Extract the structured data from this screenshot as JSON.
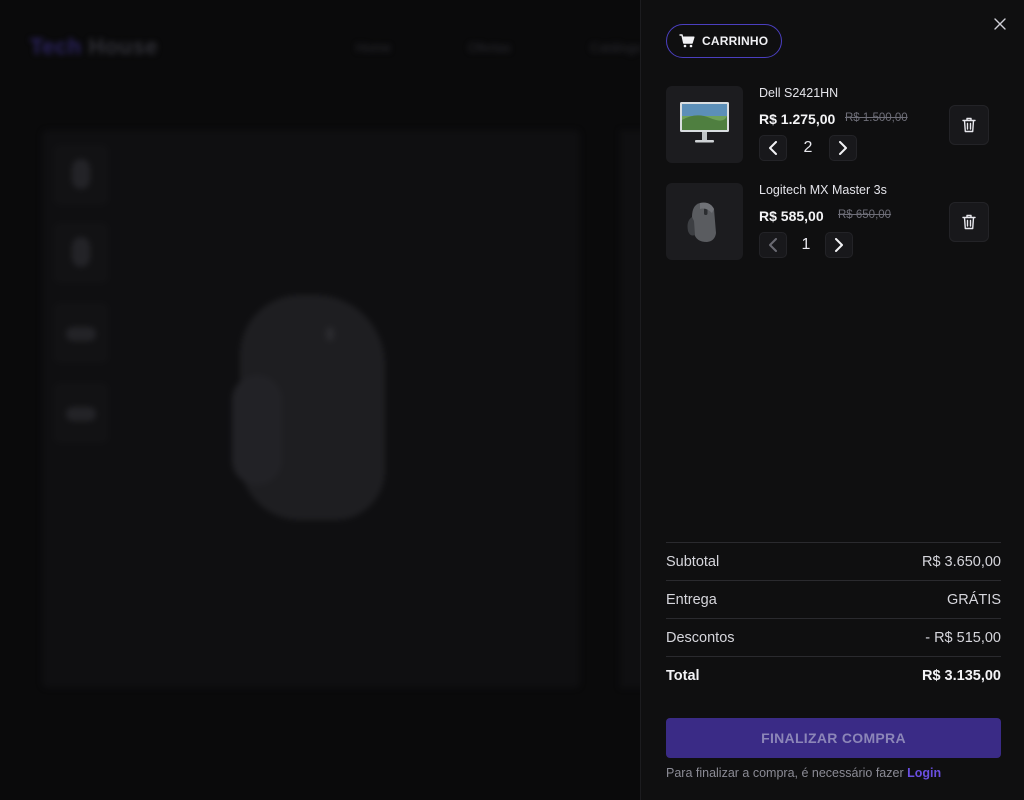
{
  "background": {
    "logo_part1": "Tech",
    "logo_part2": "House",
    "nav": [
      "Home",
      "Ofertas",
      "Catálogo"
    ]
  },
  "cart": {
    "title": "CARRINHO",
    "items": [
      {
        "name": "Dell S2421HN",
        "price": "R$ 1.275,00",
        "old_price": "R$ 1.500,00",
        "quantity": "2",
        "image_icon": "monitor-icon"
      },
      {
        "name": "Logitech MX Master 3s",
        "price": "R$ 585,00",
        "old_price": "R$ 650,00",
        "quantity": "1",
        "image_icon": "mouse-icon"
      }
    ],
    "summary": {
      "subtotal_label": "Subtotal",
      "subtotal_value": "R$ 3.650,00",
      "shipping_label": "Entrega",
      "shipping_value": "GRÁTIS",
      "discount_label": "Descontos",
      "discount_value": "- R$ 515,00",
      "total_label": "Total",
      "total_value": "R$ 3.135,00"
    },
    "checkout_label": "FINALIZAR COMPRA",
    "login_note": "Para finalizar a compra, é necessário fazer",
    "login_link": "Login"
  },
  "colors": {
    "accent": "#4b3fc0",
    "checkout_bg": "#3a2b86",
    "login_link": "#6a4fe0",
    "drawer_bg": "#0f0f10"
  }
}
